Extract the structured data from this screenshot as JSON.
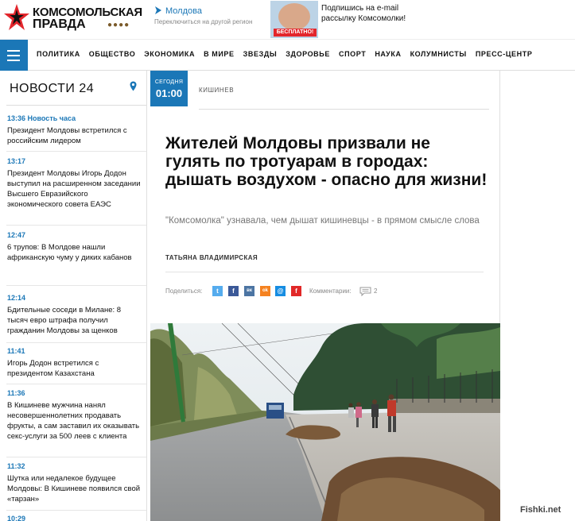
{
  "header": {
    "logo_line1": "КОМСОМОЛЬСКАЯ",
    "logo_line2": "ПРАВДА",
    "region_name": "Молдова",
    "region_switch": "Переключиться на другой регион",
    "promo_badge": "БЕСПЛАТНО!",
    "promo_text": "Подпишись на e-mail рассылку Комсомолки!"
  },
  "nav": {
    "items": [
      "ПОЛИТИКА",
      "ОБЩЕСТВО",
      "ЭКОНОМИКА",
      "В МИРЕ",
      "ЗВЕЗДЫ",
      "ЗДОРОВЬЕ",
      "СПОРТ",
      "НАУКА",
      "КОЛУМНИСТЫ",
      "ПРЕСС-ЦЕНТР"
    ]
  },
  "sidebar": {
    "title": "НОВОСТИ 24",
    "news": [
      {
        "time": "13:36 Новость часа",
        "text": "Президент Молдовы встретился с российским лидером"
      },
      {
        "time": "13:17",
        "text": "Президент Молдовы Игорь Додон выступил на расширенном заседании Высшего Евразийского экономического совета ЕАЭС"
      },
      {
        "time": "12:47",
        "text": "6 трупов: В Молдове нашли африканскую чуму у диких кабанов"
      },
      {
        "time": "12:14",
        "text": "Бдительные соседи в Милане: 8 тысяч евро штрафа получил гражданин Молдовы за щенков"
      },
      {
        "time": "11:41",
        "text": "Игорь Додон встретился с президентом Казахстана"
      },
      {
        "time": "11:36",
        "text": "В Кишиневе мужчина нанял несовершеннолетних продавать фрукты, а сам заставил их оказывать секс-услуги за 500 леев с клиента"
      },
      {
        "time": "11:32",
        "text": "Шутка или недалекое будущее Молдовы: В Кишиневе появился свой «тарзан»"
      },
      {
        "time": "10:29",
        "text": ""
      }
    ]
  },
  "article": {
    "date_label": "СЕГОДНЯ",
    "date_time": "01:00",
    "rubric": "КИШИНЕВ",
    "headline": "Жителей Молдовы призвали не гулять по тротуарам в городах: дышать воздухом - опасно для жизни!",
    "subtitle": "\"Комсомолка\" узнавала, чем дышат кишиневцы - в прямом смысле слова",
    "author": "ТАТЬЯНА ВЛАДИМИРСКАЯ",
    "share_label": "Поделиться:",
    "comments_label": "Комментарии:",
    "comments_count": "2",
    "share_buttons": [
      {
        "icon": "twitter-icon",
        "glyph": "t",
        "color": "#55acee"
      },
      {
        "icon": "facebook-icon",
        "glyph": "f",
        "color": "#3b5998"
      },
      {
        "icon": "vk-icon",
        "glyph": "вк",
        "color": "#4c75a3"
      },
      {
        "icon": "odnoklassniki-icon",
        "glyph": "ok",
        "color": "#f58220"
      },
      {
        "icon": "moimir-icon",
        "glyph": "@",
        "color": "#168de2"
      },
      {
        "icon": "flipboard-icon",
        "glyph": "f",
        "color": "#e12828"
      }
    ]
  },
  "watermark": "Fishki.net",
  "colors": {
    "accent": "#1b77b7",
    "brand_red": "#e3262c"
  }
}
